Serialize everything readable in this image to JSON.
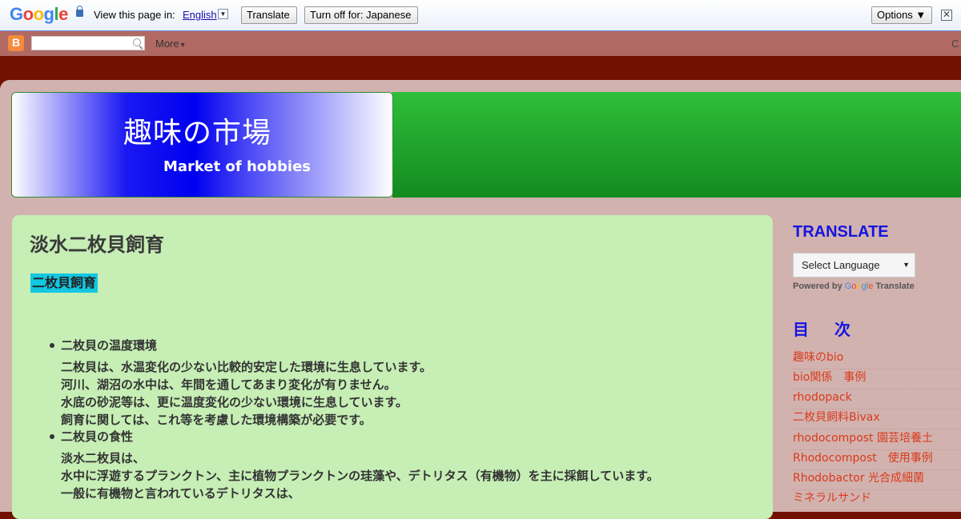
{
  "translate_bar": {
    "logo": "Google",
    "prompt": "View this page in:",
    "language": "English",
    "dropdown_glyph": "▼",
    "translate_label": "Translate",
    "turn_off_label": "Turn off for: Japanese",
    "options_label": "Options ▼",
    "close_glyph": "✕"
  },
  "navbar": {
    "search_placeholder": "",
    "more_label": "More",
    "more_arrow": "▾",
    "right_text": "C"
  },
  "header": {
    "title": "趣味の市場",
    "subtitle": "Market of hobbies"
  },
  "post": {
    "title": "淡水二枚貝飼育",
    "highlight": "二枚貝飼育",
    "lines": [
      "二枚貝の温度環境",
      "二枚貝は、水温変化の少ない比較的安定した環境に生息しています。",
      "河川、湖沼の水中は、年間を通してあまり変化が有りません。",
      "水底の砂泥等は、更に温度変化の少ない環境に生息しています。",
      "飼育に関しては、これ等を考慮した環境構築が必要です。",
      "二枚貝の食性",
      "淡水二枚貝は、",
      "水中に浮遊するプランクトン、主に植物プランクトンの珪藻や、デトリタス（有機物）を主に採餌しています。",
      "一般に有機物と言われているデトリタスは、"
    ]
  },
  "sidebar": {
    "translate_title": "TRANSLATE",
    "select_label": "Select Language",
    "select_arrow": "▼",
    "powered_by": "Powered by",
    "google_word": "Google",
    "translate_word": "Translate",
    "toc_title": "目　次",
    "toc": [
      "趣味のbio",
      "bio関係　事例",
      "rhodopack",
      "二枚貝飼料Bivax",
      "rhodocompost 園芸培養土",
      "Rhodocompost　使用事例",
      "Rhodobactor 光合成細菌",
      "ミネラルサンド"
    ]
  },
  "colors": {
    "google_blue": "#4285f4",
    "google_red": "#ea4335",
    "google_yellow": "#fbbc05",
    "google_green": "#34a853",
    "sidebar_heading": "#1414e0",
    "link": "#d93a1c",
    "post_bg": "#c6eeb5",
    "highlight": "#12c7e1"
  }
}
